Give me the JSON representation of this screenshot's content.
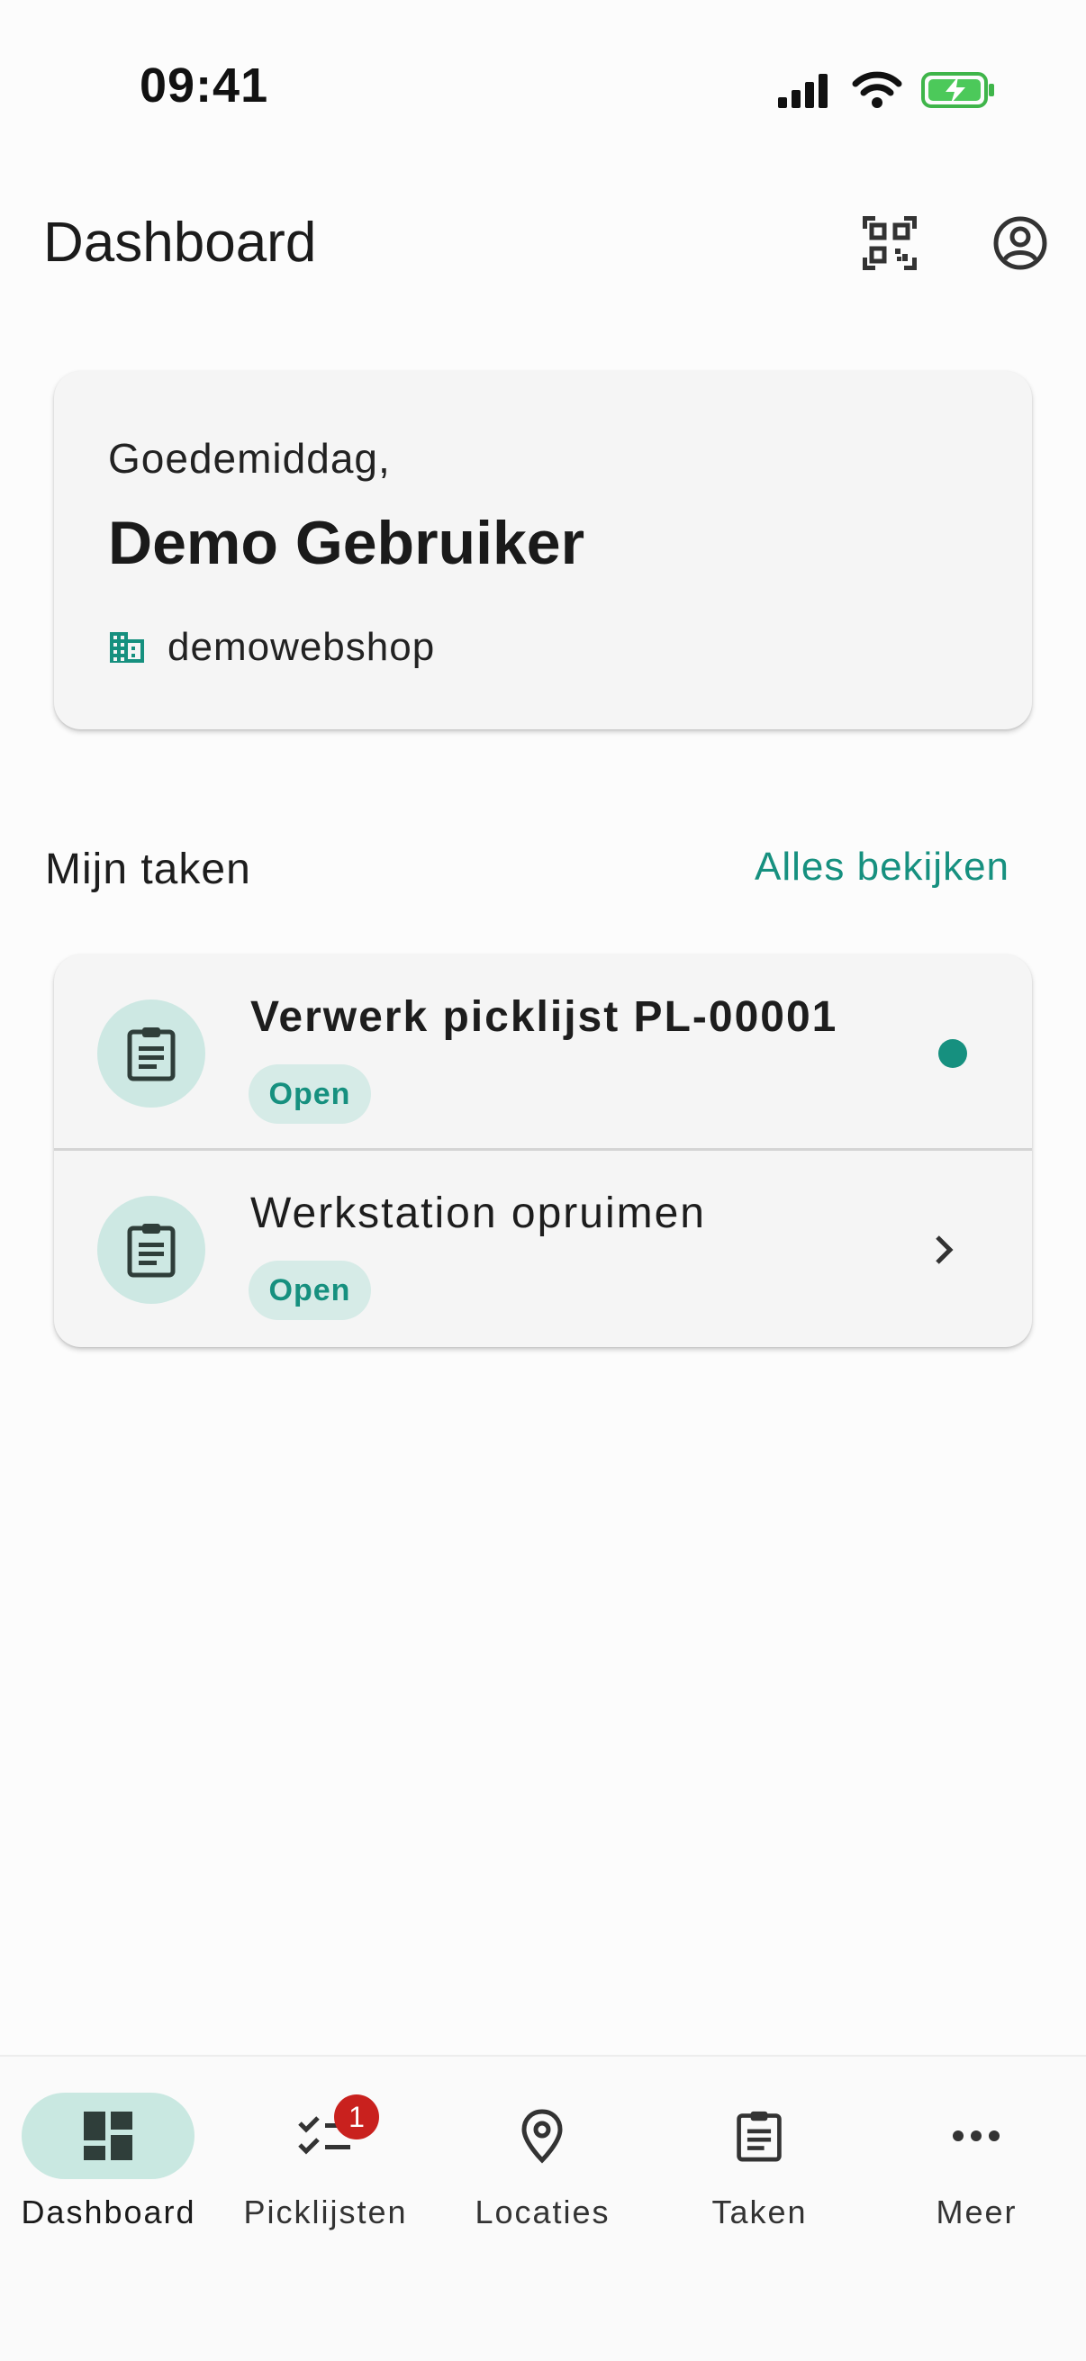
{
  "status_bar": {
    "time": "09:41"
  },
  "header": {
    "title": "Dashboard",
    "qr_icon": "qr-code-scanner-icon",
    "account_icon": "account-circle-icon"
  },
  "greeting": {
    "salutation": "Goedemiddag,",
    "user_name": "Demo Gebruiker",
    "company": "demowebshop",
    "company_icon": "building-icon"
  },
  "tasks": {
    "section_title": "Mijn taken",
    "view_all": "Alles bekijken",
    "items": [
      {
        "title": "Verwerk picklijst PL-00001",
        "status": "Open",
        "unread": true
      },
      {
        "title": "Werkstation opruimen",
        "status": "Open",
        "unread": false
      }
    ]
  },
  "nav": {
    "items": [
      {
        "label": "Dashboard",
        "icon": "dashboard-icon",
        "active": true
      },
      {
        "label": "Picklijsten",
        "icon": "checklist-icon",
        "badge": "1"
      },
      {
        "label": "Locaties",
        "icon": "location-pin-icon"
      },
      {
        "label": "Taken",
        "icon": "clipboard-icon"
      },
      {
        "label": "Meer",
        "icon": "more-horizontal-icon"
      }
    ]
  },
  "colors": {
    "accent": "#16907f",
    "badge": "#c9211e",
    "chip_bg": "#d6ebe7",
    "active_nav_bg": "#c9e8e1"
  }
}
